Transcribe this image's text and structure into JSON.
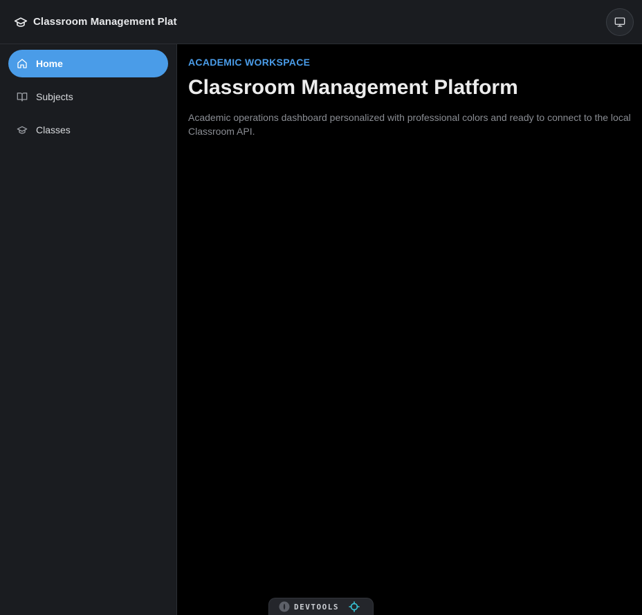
{
  "header": {
    "app_title": "Classroom Management Platform",
    "brand_icon": "graduation-cap-icon",
    "display_button_icon": "monitor-icon"
  },
  "sidebar": {
    "items": [
      {
        "label": "Home",
        "icon": "home-icon",
        "active": true
      },
      {
        "label": "Subjects",
        "icon": "book-icon",
        "active": false
      },
      {
        "label": "Classes",
        "icon": "graduation-cap-icon",
        "active": false
      }
    ]
  },
  "main": {
    "eyebrow": "ACADEMIC WORKSPACE",
    "title": "Classroom Management Platform",
    "description": "Academic operations dashboard personalized with professional colors and ready to connect to the local Classroom API."
  },
  "devtools": {
    "label": "DEVTOOLS"
  },
  "colors": {
    "accent": "#4a9ce8",
    "background": "#000000",
    "panel": "#1a1c20",
    "devtools_target": "#37c5d6"
  }
}
